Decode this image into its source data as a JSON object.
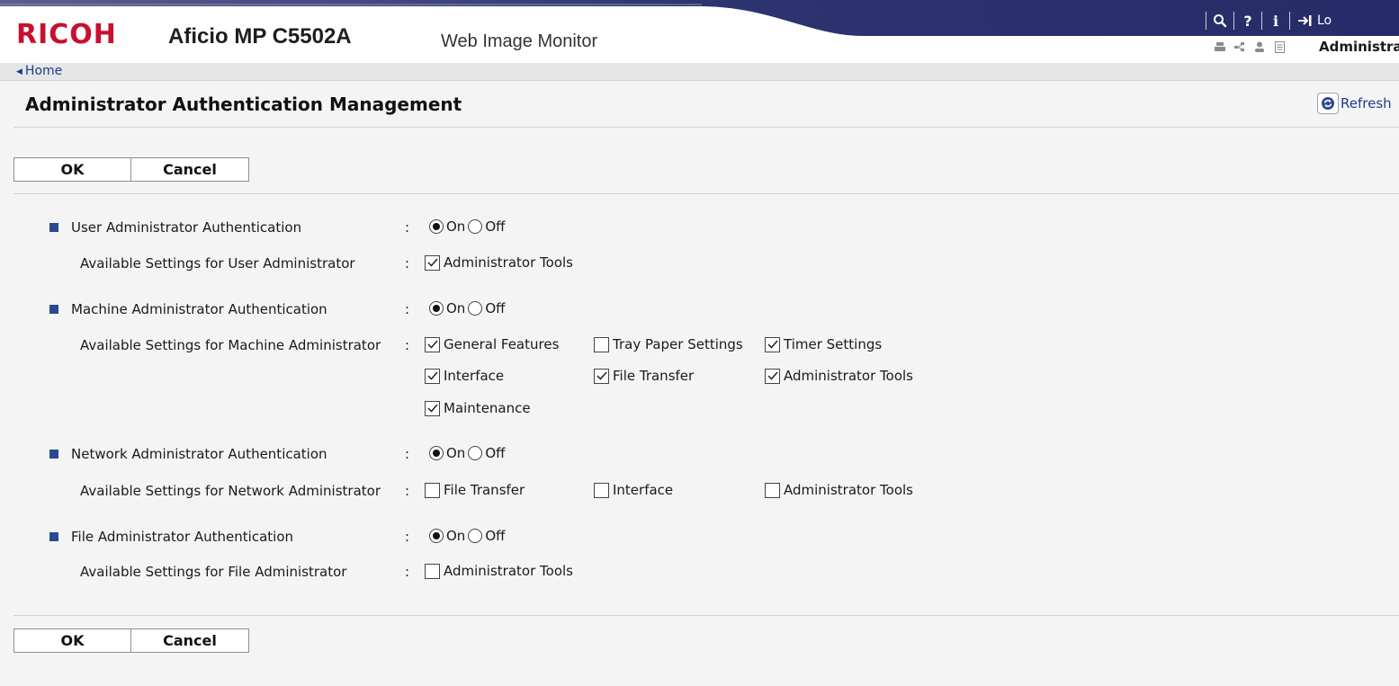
{
  "header": {
    "logo": "RICOH",
    "model": "Aficio MP C5502A",
    "app_title": "Web Image Monitor",
    "logout_label": "Lo",
    "user": "Administra",
    "toolbar_icons": [
      "search-icon",
      "help-icon",
      "info-icon",
      "logout-icon"
    ],
    "status_icons": [
      "printer-status-icon",
      "network-status-icon",
      "user-status-icon",
      "document-status-icon"
    ],
    "band_color": "#262c67"
  },
  "breadcrumb": {
    "home": "Home"
  },
  "page": {
    "title": "Administrator Authentication Management",
    "refresh": "Refresh"
  },
  "buttons": {
    "ok": "OK",
    "cancel": "Cancel"
  },
  "common": {
    "colon": ":",
    "on": "On",
    "off": "Off"
  },
  "sections": [
    {
      "label": "User Administrator Authentication",
      "auth": "On",
      "sub_label": "Available Settings for User Administrator",
      "options": [
        {
          "label": "Administrator Tools",
          "checked": true
        }
      ]
    },
    {
      "label": "Machine Administrator Authentication",
      "auth": "On",
      "sub_label": "Available Settings for Machine Administrator",
      "options": [
        {
          "label": "General Features",
          "checked": true
        },
        {
          "label": "Tray Paper Settings",
          "checked": false
        },
        {
          "label": "Timer Settings",
          "checked": true
        },
        {
          "label": "Interface",
          "checked": true
        },
        {
          "label": "File Transfer",
          "checked": true
        },
        {
          "label": "Administrator Tools",
          "checked": true
        },
        {
          "label": "Maintenance",
          "checked": true
        }
      ]
    },
    {
      "label": "Network Administrator Authentication",
      "auth": "On",
      "sub_label": "Available Settings for Network Administrator",
      "options": [
        {
          "label": "File Transfer",
          "checked": false
        },
        {
          "label": "Interface",
          "checked": false
        },
        {
          "label": "Administrator Tools",
          "checked": false
        }
      ]
    },
    {
      "label": "File Administrator Authentication",
      "auth": "On",
      "sub_label": "Available Settings for File Administrator",
      "options": [
        {
          "label": "Administrator Tools",
          "checked": false
        }
      ]
    }
  ]
}
